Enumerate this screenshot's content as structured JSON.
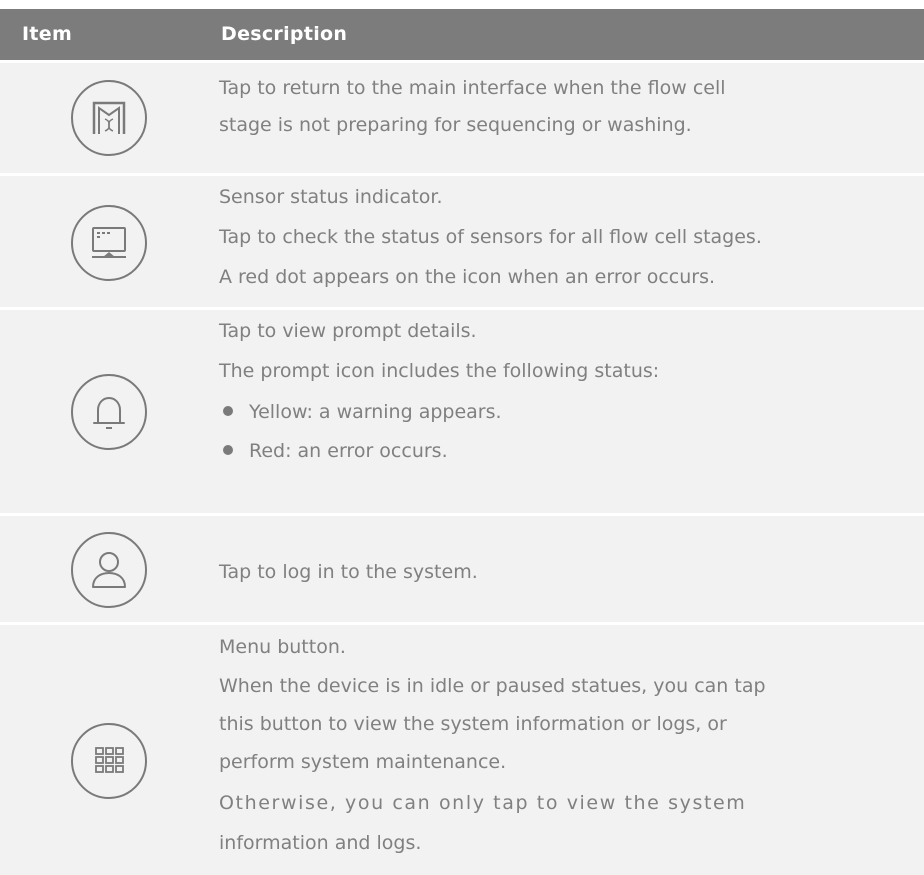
{
  "header": {
    "item": "Item",
    "description": "Description"
  },
  "rows": [
    {
      "icon": "home-logo-icon",
      "lines": [
        "Tap to return to the main interface when the flow cell",
        "stage is not preparing for sequencing or washing."
      ]
    },
    {
      "icon": "sensor-monitor-icon",
      "lines": [
        "Sensor status indicator.",
        "Tap to check the status of sensors for all flow cell stages.",
        "A red dot appears on the icon when an error occurs."
      ]
    },
    {
      "icon": "bell-icon",
      "lines": [
        "Tap to view prompt details.",
        "The prompt icon includes the following status:"
      ],
      "bullets": [
        "Yellow: a warning appears.",
        "Red: an error occurs."
      ]
    },
    {
      "icon": "user-icon",
      "lines": [
        "Tap to log in to the system."
      ]
    },
    {
      "icon": "grid-menu-icon",
      "lines": [
        "Menu button.",
        "When the device is in idle or paused statues, you can tap",
        "this button to view the system information or logs, or",
        "perform system maintenance.",
        "Otherwise, you can only tap to view the system",
        "information and logs."
      ]
    }
  ]
}
